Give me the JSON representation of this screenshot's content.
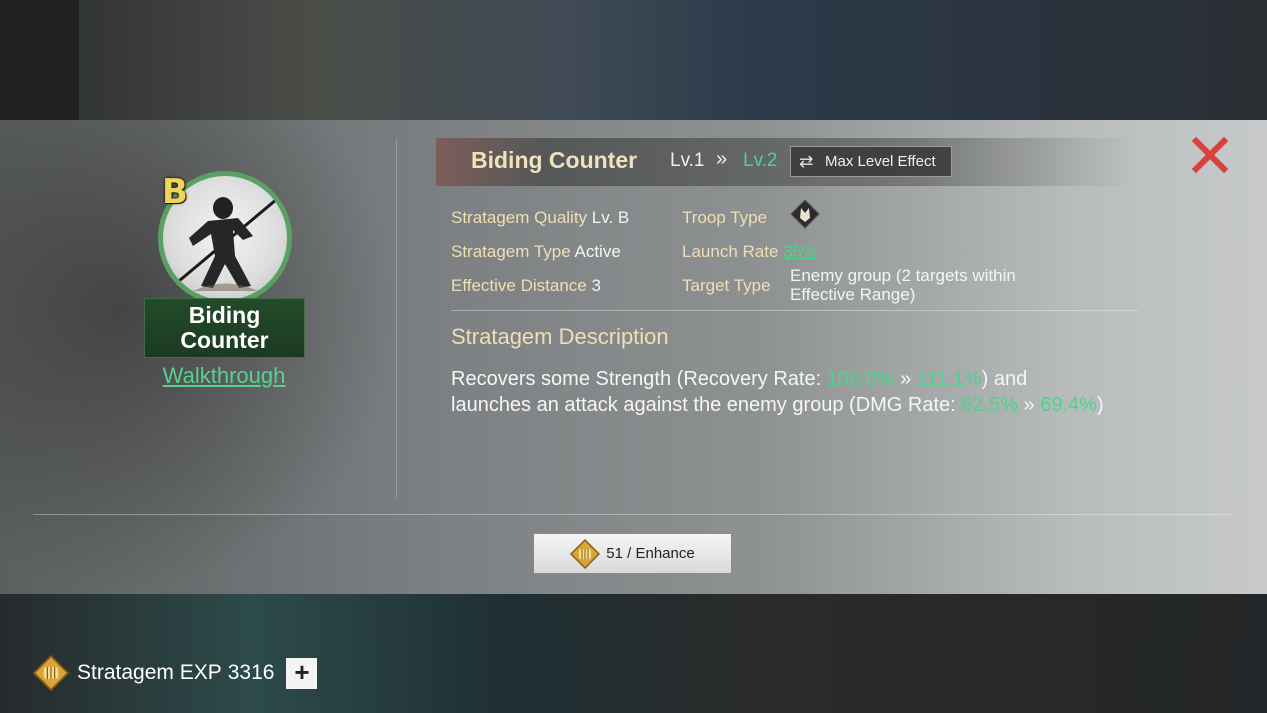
{
  "skill": {
    "grade": "B",
    "name": "Biding Counter",
    "name_plate": "Biding Counter",
    "walkthrough_label": "Walkthrough",
    "level_from": "Lv.1",
    "level_arrow": "»",
    "level_to": "Lv.2",
    "max_level_label": "Max Level Effect"
  },
  "attributes": {
    "quality_key": "Stratagem Quality",
    "quality_val": "Lv. B",
    "type_key": "Stratagem Type",
    "type_val": "Active",
    "distance_key": "Effective Distance",
    "distance_val": "3",
    "troop_key": "Troop Type",
    "launch_key": "Launch Rate",
    "launch_val": "35%",
    "target_key": "Target Type",
    "target_val": "Enemy group (2 targets within Effective Range)"
  },
  "description": {
    "title": "Stratagem Description",
    "p1": "Recovers some Strength (Recovery Rate: ",
    "g1": "100.0%",
    "p2": " » ",
    "g2": "111.1%",
    "p3": ") and launches an attack against the enemy group (DMG Rate: ",
    "g3": "62.5%",
    "p4": " » ",
    "g4": "69.4%",
    "p5": ")"
  },
  "enhance": {
    "cost": "51",
    "label": "51 / Enhance"
  },
  "bottom_bar": {
    "exp_label": "Stratagem EXP",
    "exp_value": "3316",
    "plus": "+"
  },
  "colors": {
    "accent_green": "#4dd48c",
    "title_gold": "#efdfb4",
    "close_red": "#d9413e"
  }
}
